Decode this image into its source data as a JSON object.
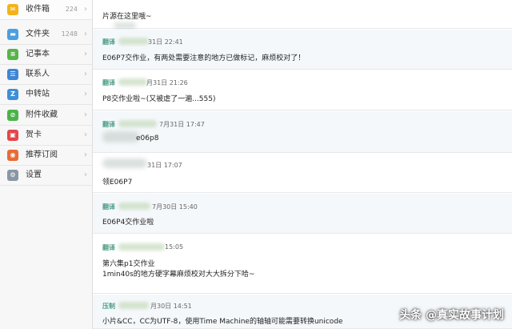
{
  "sidebar": {
    "items": [
      {
        "label": "收件箱",
        "count": "224",
        "icon": "envelope-icon",
        "color": "#f3b31a",
        "glyph": "✉"
      },
      {
        "label": "文件夹",
        "count": "1248",
        "icon": "folder-icon",
        "color": "#4a9fe0",
        "glyph": "▬"
      },
      {
        "label": "记事本",
        "count": "",
        "icon": "notepad-icon",
        "color": "#58b44a",
        "glyph": "≡"
      },
      {
        "label": "联系人",
        "count": "",
        "icon": "contacts-icon",
        "color": "#3e86d6",
        "glyph": "☰"
      },
      {
        "label": "中转站",
        "count": "",
        "icon": "transfer-icon",
        "color": "#3d8fd8",
        "glyph": "Z"
      },
      {
        "label": "附件收藏",
        "count": "",
        "icon": "attachment-icon",
        "color": "#4cb34a",
        "glyph": "⊘"
      },
      {
        "label": "贺卡",
        "count": "",
        "icon": "card-icon",
        "color": "#e2474b",
        "glyph": "▣"
      },
      {
        "label": "推荐订阅",
        "count": "",
        "icon": "subscribe-icon",
        "color": "#e96b35",
        "glyph": "◉"
      },
      {
        "label": "设置",
        "count": "",
        "icon": "gear-icon",
        "color": "#8a96a6",
        "glyph": "⚙"
      }
    ],
    "chevron": "›"
  },
  "messages": [
    {
      "sender": "",
      "date": "",
      "lines": [
        "片源在这里哦~"
      ]
    },
    {
      "sender": "翻译",
      "date": "31日 22:41",
      "lines": [
        "E06P7交作业，有两处需要注意的地方已做标记，麻烦校对了！"
      ]
    },
    {
      "sender": "翻译",
      "date": "月31日 21:26",
      "lines": [
        "P8交作业啦~(又被虐了一遍...555)"
      ]
    },
    {
      "sender": "翻译",
      "date": "7月31日 17:47",
      "lines": [
        "e06p8"
      ]
    },
    {
      "sender": "",
      "date": "31日 17:07",
      "lines": [
        "领E06P7"
      ]
    },
    {
      "sender": "翻译",
      "date": "7月30日 15:40",
      "lines": [
        "E06P4交作业啦"
      ]
    },
    {
      "sender": "翻译",
      "date": "15:05",
      "lines": [
        "第六集p1交作业",
        "1min40s的地方硬字幕麻烦校对大大拆分下哈~"
      ]
    },
    {
      "sender": "压制",
      "date": "月30日 14:51",
      "lines": [
        "小片&CC，CC为UTF-8，使用Time Machine的轴轴可能需要转换unicode"
      ]
    }
  ],
  "watermark": "头条 @真实故事计划"
}
